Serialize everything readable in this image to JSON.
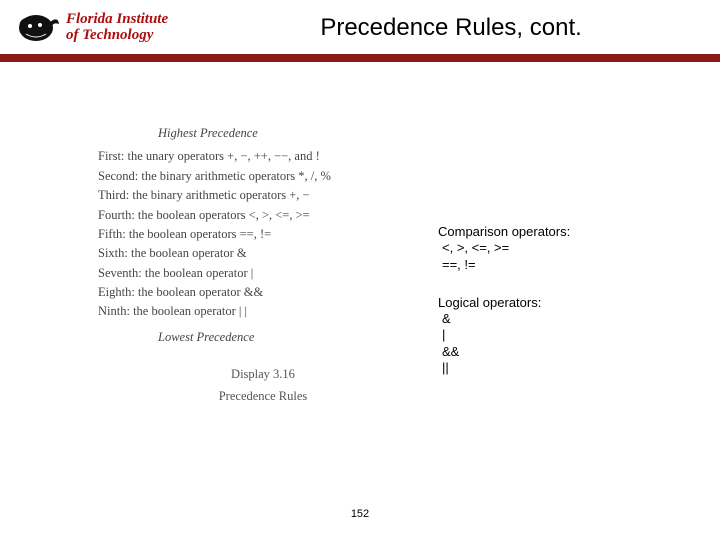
{
  "header": {
    "institution_line1": "Florida Institute",
    "institution_line2": "of Technology",
    "title": "Precedence Rules, cont."
  },
  "precedence": {
    "heading": "Highest Precedence",
    "items": [
      "First: the unary operators +, −, ++, −−, and !",
      "Second: the binary arithmetic operators *, /, %",
      "Third: the binary arithmetic operators +, −",
      "Fourth: the boolean operators <, >, <=, >=",
      "Fifth: the boolean operators ==, !=",
      "Sixth: the boolean operator &",
      "Seventh: the boolean operator |",
      "Eighth: the boolean operator &&",
      "Ninth: the boolean operator | |"
    ],
    "footing": "Lowest Precedence",
    "caption_display": "Display 3.16",
    "caption_title": "Precedence Rules"
  },
  "notes": {
    "comparison": {
      "title": "Comparison operators:",
      "lines": [
        "<, >, <=, >=",
        "==, !="
      ]
    },
    "logical": {
      "title": "Logical operators:",
      "lines": [
        "&",
        "|",
        "&&",
        "||"
      ]
    }
  },
  "page_number": "152"
}
